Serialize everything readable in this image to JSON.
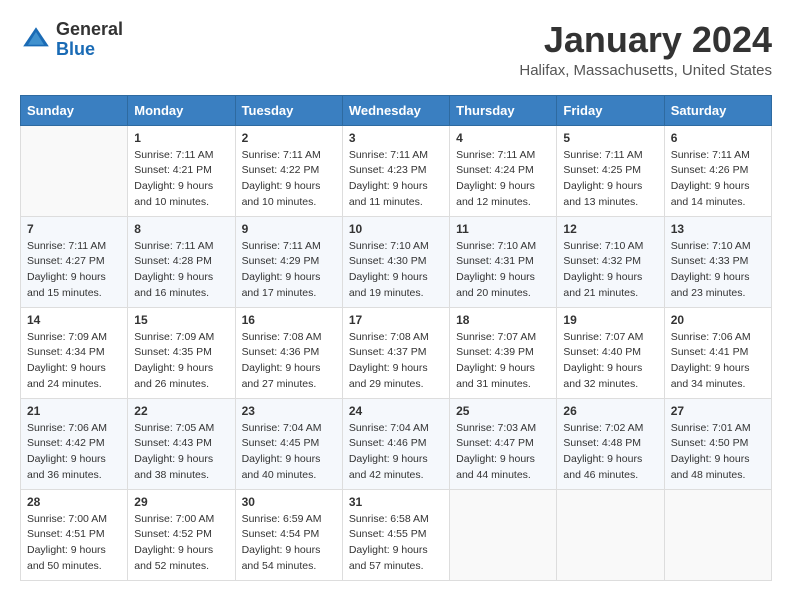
{
  "header": {
    "logo": {
      "line1": "General",
      "line2": "Blue"
    },
    "title": "January 2024",
    "location": "Halifax, Massachusetts, United States"
  },
  "calendar": {
    "days_of_week": [
      "Sunday",
      "Monday",
      "Tuesday",
      "Wednesday",
      "Thursday",
      "Friday",
      "Saturday"
    ],
    "weeks": [
      [
        {
          "day": "",
          "sunrise": "",
          "sunset": "",
          "daylight": ""
        },
        {
          "day": "1",
          "sunrise": "Sunrise: 7:11 AM",
          "sunset": "Sunset: 4:21 PM",
          "daylight": "Daylight: 9 hours and 10 minutes."
        },
        {
          "day": "2",
          "sunrise": "Sunrise: 7:11 AM",
          "sunset": "Sunset: 4:22 PM",
          "daylight": "Daylight: 9 hours and 10 minutes."
        },
        {
          "day": "3",
          "sunrise": "Sunrise: 7:11 AM",
          "sunset": "Sunset: 4:23 PM",
          "daylight": "Daylight: 9 hours and 11 minutes."
        },
        {
          "day": "4",
          "sunrise": "Sunrise: 7:11 AM",
          "sunset": "Sunset: 4:24 PM",
          "daylight": "Daylight: 9 hours and 12 minutes."
        },
        {
          "day": "5",
          "sunrise": "Sunrise: 7:11 AM",
          "sunset": "Sunset: 4:25 PM",
          "daylight": "Daylight: 9 hours and 13 minutes."
        },
        {
          "day": "6",
          "sunrise": "Sunrise: 7:11 AM",
          "sunset": "Sunset: 4:26 PM",
          "daylight": "Daylight: 9 hours and 14 minutes."
        }
      ],
      [
        {
          "day": "7",
          "sunrise": "Sunrise: 7:11 AM",
          "sunset": "Sunset: 4:27 PM",
          "daylight": "Daylight: 9 hours and 15 minutes."
        },
        {
          "day": "8",
          "sunrise": "Sunrise: 7:11 AM",
          "sunset": "Sunset: 4:28 PM",
          "daylight": "Daylight: 9 hours and 16 minutes."
        },
        {
          "day": "9",
          "sunrise": "Sunrise: 7:11 AM",
          "sunset": "Sunset: 4:29 PM",
          "daylight": "Daylight: 9 hours and 17 minutes."
        },
        {
          "day": "10",
          "sunrise": "Sunrise: 7:10 AM",
          "sunset": "Sunset: 4:30 PM",
          "daylight": "Daylight: 9 hours and 19 minutes."
        },
        {
          "day": "11",
          "sunrise": "Sunrise: 7:10 AM",
          "sunset": "Sunset: 4:31 PM",
          "daylight": "Daylight: 9 hours and 20 minutes."
        },
        {
          "day": "12",
          "sunrise": "Sunrise: 7:10 AM",
          "sunset": "Sunset: 4:32 PM",
          "daylight": "Daylight: 9 hours and 21 minutes."
        },
        {
          "day": "13",
          "sunrise": "Sunrise: 7:10 AM",
          "sunset": "Sunset: 4:33 PM",
          "daylight": "Daylight: 9 hours and 23 minutes."
        }
      ],
      [
        {
          "day": "14",
          "sunrise": "Sunrise: 7:09 AM",
          "sunset": "Sunset: 4:34 PM",
          "daylight": "Daylight: 9 hours and 24 minutes."
        },
        {
          "day": "15",
          "sunrise": "Sunrise: 7:09 AM",
          "sunset": "Sunset: 4:35 PM",
          "daylight": "Daylight: 9 hours and 26 minutes."
        },
        {
          "day": "16",
          "sunrise": "Sunrise: 7:08 AM",
          "sunset": "Sunset: 4:36 PM",
          "daylight": "Daylight: 9 hours and 27 minutes."
        },
        {
          "day": "17",
          "sunrise": "Sunrise: 7:08 AM",
          "sunset": "Sunset: 4:37 PM",
          "daylight": "Daylight: 9 hours and 29 minutes."
        },
        {
          "day": "18",
          "sunrise": "Sunrise: 7:07 AM",
          "sunset": "Sunset: 4:39 PM",
          "daylight": "Daylight: 9 hours and 31 minutes."
        },
        {
          "day": "19",
          "sunrise": "Sunrise: 7:07 AM",
          "sunset": "Sunset: 4:40 PM",
          "daylight": "Daylight: 9 hours and 32 minutes."
        },
        {
          "day": "20",
          "sunrise": "Sunrise: 7:06 AM",
          "sunset": "Sunset: 4:41 PM",
          "daylight": "Daylight: 9 hours and 34 minutes."
        }
      ],
      [
        {
          "day": "21",
          "sunrise": "Sunrise: 7:06 AM",
          "sunset": "Sunset: 4:42 PM",
          "daylight": "Daylight: 9 hours and 36 minutes."
        },
        {
          "day": "22",
          "sunrise": "Sunrise: 7:05 AM",
          "sunset": "Sunset: 4:43 PM",
          "daylight": "Daylight: 9 hours and 38 minutes."
        },
        {
          "day": "23",
          "sunrise": "Sunrise: 7:04 AM",
          "sunset": "Sunset: 4:45 PM",
          "daylight": "Daylight: 9 hours and 40 minutes."
        },
        {
          "day": "24",
          "sunrise": "Sunrise: 7:04 AM",
          "sunset": "Sunset: 4:46 PM",
          "daylight": "Daylight: 9 hours and 42 minutes."
        },
        {
          "day": "25",
          "sunrise": "Sunrise: 7:03 AM",
          "sunset": "Sunset: 4:47 PM",
          "daylight": "Daylight: 9 hours and 44 minutes."
        },
        {
          "day": "26",
          "sunrise": "Sunrise: 7:02 AM",
          "sunset": "Sunset: 4:48 PM",
          "daylight": "Daylight: 9 hours and 46 minutes."
        },
        {
          "day": "27",
          "sunrise": "Sunrise: 7:01 AM",
          "sunset": "Sunset: 4:50 PM",
          "daylight": "Daylight: 9 hours and 48 minutes."
        }
      ],
      [
        {
          "day": "28",
          "sunrise": "Sunrise: 7:00 AM",
          "sunset": "Sunset: 4:51 PM",
          "daylight": "Daylight: 9 hours and 50 minutes."
        },
        {
          "day": "29",
          "sunrise": "Sunrise: 7:00 AM",
          "sunset": "Sunset: 4:52 PM",
          "daylight": "Daylight: 9 hours and 52 minutes."
        },
        {
          "day": "30",
          "sunrise": "Sunrise: 6:59 AM",
          "sunset": "Sunset: 4:54 PM",
          "daylight": "Daylight: 9 hours and 54 minutes."
        },
        {
          "day": "31",
          "sunrise": "Sunrise: 6:58 AM",
          "sunset": "Sunset: 4:55 PM",
          "daylight": "Daylight: 9 hours and 57 minutes."
        },
        {
          "day": "",
          "sunrise": "",
          "sunset": "",
          "daylight": ""
        },
        {
          "day": "",
          "sunrise": "",
          "sunset": "",
          "daylight": ""
        },
        {
          "day": "",
          "sunrise": "",
          "sunset": "",
          "daylight": ""
        }
      ]
    ]
  }
}
